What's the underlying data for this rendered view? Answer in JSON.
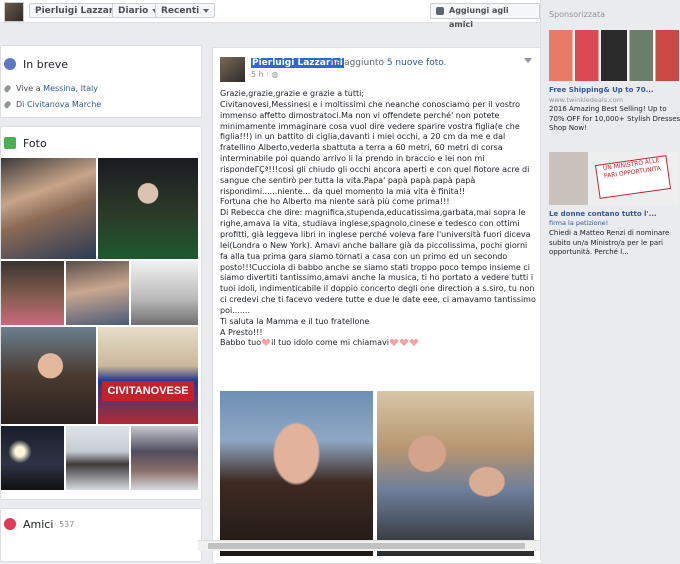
{
  "topbar": {
    "profile_name": "Pierluigi Lazzarini",
    "diario_label": "Diario",
    "recenti_label": "Recenti",
    "add_friends_label": "Aggiungi agli amici"
  },
  "intro": {
    "title": "In breve",
    "lives_prefix": "Vive a ",
    "lives_city": "Messina, Italy",
    "from_prefix": "Di ",
    "from_city": "Civitanova Marche"
  },
  "photos": {
    "title": "Foto",
    "banner_text": "CIVITANOVESE"
  },
  "friends": {
    "title": "Amici",
    "count": "537"
  },
  "post": {
    "author": "Pierluigi Lazzarini",
    "action_prefix": "ha aggiunto ",
    "action_count": "5 nuove foto",
    "action_suffix": ".",
    "time": "5 h",
    "text_lines": [
      "Grazie,grazie,grazie e grazie a tutti;",
      "Civitanovesi,Messinesi e i moltissimi che neanche conosciamo per il vostro immenso affetto dimostratoci.Ma non vi offendete perché' non potete minimamente immaginare cosa vuol dire vedere sparire vostra figlia(e che figlia!!!) in un battito di ciglia,davanti i miei occhi, a 20 cm da me e dal fratellino Alberto,vederla sbattuta a terra a 60 metri, 60 metri di corsa interminabile poi quando arrivo li la prendo in braccio e lei non mi rispondeΓÇª!!!così gli chiudo gli occhi ancora aperti e con quel fiotore acre di sangue che sentirò per tutta la vita.Papa' papà papà papà papà rispondimi......niente... da quel momento la mia vita è finita!!",
      "Fortuna che ho Alberto ma niente sarà più come prima!!!",
      "Di Rebecca che dire: magnifica,stupenda,educatissima,garbata,mai sopra le righe,amava la vita, studiava inglese,spagnolo,cinese e tedesco con ottimi profitti, già leggeva libri in inglese perché voleva fare l'università fuori diceva lei(Londra o New York). Amavi anche ballare già da piccolissima, pochi giorni fa alla tua prima gara siamo tornati a casa con un primo ed un secondo posto!!!Cucciola di babbo anche se siamo stati troppo poco tempo insieme ci siamo divertiti tantissimo,amavi anche la musica, ti ho portato a vedere tutti i tuoi idoli, indimenticabile il doppio concerto degli one direction a s.siro, tu non ci credevi che ti facevo vedere tutte e due le date eee, ci amavamo tantissimo poi.......",
      "Ti saluta la Mamma e il tuo fratellone",
      "A Presto!!!",
      "Babbo tuo",
      "il tuo idolo come mi chiamavi"
    ]
  },
  "sponsored": {
    "header": "Sponsorizzata",
    "ad1": {
      "title": "Free Shipping& Up to 70...",
      "url": "www.twinkledeals.com",
      "body": "2016 Amazing Best Selling! Up to 70% OFF for 10,000+ Stylish Dresses! Shop Now!"
    },
    "ad2": {
      "sign_text": "UN MINISTRO ALLE PARI OPPORTUNITA",
      "title": "Le donne contano tutto l'...",
      "subtitle": "firma la petizione!",
      "body": "Chiedi a Matteo Renzi di nominare subito un/a Ministro/a per le pari opportunità. Perché l..."
    }
  },
  "colors": {
    "fb_blue": "#365899",
    "highlight": "#2a6ad6",
    "heart": "#f0a3a3"
  }
}
